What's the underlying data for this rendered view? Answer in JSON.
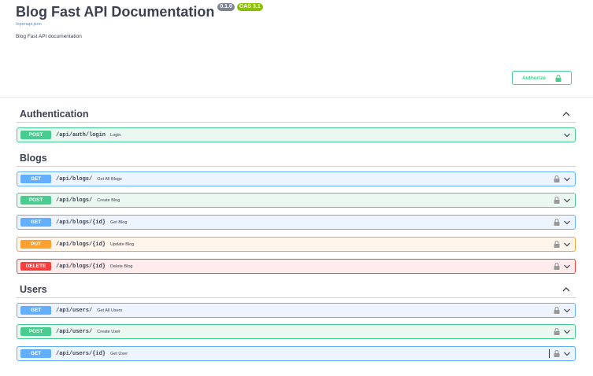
{
  "info": {
    "title": "Blog Fast API Documentation",
    "version": "0.1.0",
    "oas": "OAS 3.1",
    "openapi_link": "/openapi.json",
    "description": "Blog Fast API documentation"
  },
  "authorize": {
    "label": "Authorize"
  },
  "tags": [
    {
      "name": "Authentication",
      "operations": [
        {
          "method": "POST",
          "path": "/api/auth/login",
          "summary": "Login"
        }
      ]
    },
    {
      "name": "Blogs",
      "operations": [
        {
          "method": "GET",
          "path": "/api/blogs/",
          "summary": "Get All Blogs"
        },
        {
          "method": "POST",
          "path": "/api/blogs/",
          "summary": "Create Blog"
        },
        {
          "method": "GET",
          "path": "/api/blogs/{id}",
          "summary": "Get Blog"
        },
        {
          "method": "PUT",
          "path": "/api/blogs/{id}",
          "summary": "Update Blog"
        },
        {
          "method": "DELETE",
          "path": "/api/blogs/{id}",
          "summary": "Delete Blog"
        }
      ]
    },
    {
      "name": "Users",
      "operations": [
        {
          "method": "GET",
          "path": "/api/users/",
          "summary": "Get All Users"
        },
        {
          "method": "POST",
          "path": "/api/users/",
          "summary": "Create User"
        },
        {
          "method": "GET",
          "path": "/api/users/{id}",
          "summary": "Get User"
        }
      ]
    }
  ],
  "icons": {
    "lock": "lock-icon",
    "chevron_up": "chevron-up-icon",
    "chevron_down": "chevron-down-icon"
  },
  "colors": {
    "post": "#49cc90",
    "get": "#61affe",
    "put": "#fca130",
    "delete": "#f93e3e",
    "version_badge": "#7d8492",
    "oas_badge": "#89bf04"
  }
}
